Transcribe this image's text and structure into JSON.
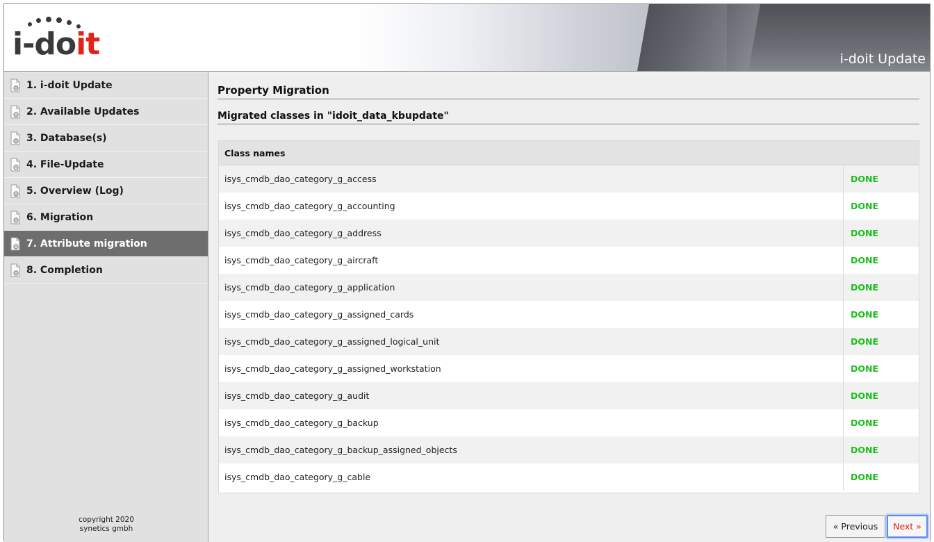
{
  "header": {
    "logo_prefix": "i-do",
    "logo_suffix": "it",
    "title": "i-doit Update"
  },
  "sidebar": {
    "items": [
      {
        "label": "1. i-doit Update",
        "active": false
      },
      {
        "label": "2. Available Updates",
        "active": false
      },
      {
        "label": "3. Database(s)",
        "active": false
      },
      {
        "label": "4. File-Update",
        "active": false
      },
      {
        "label": "5. Overview (Log)",
        "active": false
      },
      {
        "label": "6. Migration",
        "active": false
      },
      {
        "label": "7. Attribute migration",
        "active": true
      },
      {
        "label": "8. Completion",
        "active": false
      }
    ],
    "copyright_line1": "copyright 2020",
    "copyright_line2": "synetics gmbh"
  },
  "main": {
    "title": "Property Migration",
    "subtitle": "Migrated classes in \"idoit_data_kbupdate\"",
    "table": {
      "header": "Class names",
      "rows": [
        {
          "name": "isys_cmdb_dao_category_g_access",
          "status": "DONE"
        },
        {
          "name": "isys_cmdb_dao_category_g_accounting",
          "status": "DONE"
        },
        {
          "name": "isys_cmdb_dao_category_g_address",
          "status": "DONE"
        },
        {
          "name": "isys_cmdb_dao_category_g_aircraft",
          "status": "DONE"
        },
        {
          "name": "isys_cmdb_dao_category_g_application",
          "status": "DONE"
        },
        {
          "name": "isys_cmdb_dao_category_g_assigned_cards",
          "status": "DONE"
        },
        {
          "name": "isys_cmdb_dao_category_g_assigned_logical_unit",
          "status": "DONE"
        },
        {
          "name": "isys_cmdb_dao_category_g_assigned_workstation",
          "status": "DONE"
        },
        {
          "name": "isys_cmdb_dao_category_g_audit",
          "status": "DONE"
        },
        {
          "name": "isys_cmdb_dao_category_g_backup",
          "status": "DONE"
        },
        {
          "name": "isys_cmdb_dao_category_g_backup_assigned_objects",
          "status": "DONE"
        },
        {
          "name": "isys_cmdb_dao_category_g_cable",
          "status": "DONE"
        }
      ]
    },
    "buttons": {
      "previous": "« Previous",
      "next": "Next »"
    }
  },
  "colors": {
    "done": "#19c01b",
    "accent_red": "#e2231a",
    "active_nav": "#6e6e6e"
  }
}
